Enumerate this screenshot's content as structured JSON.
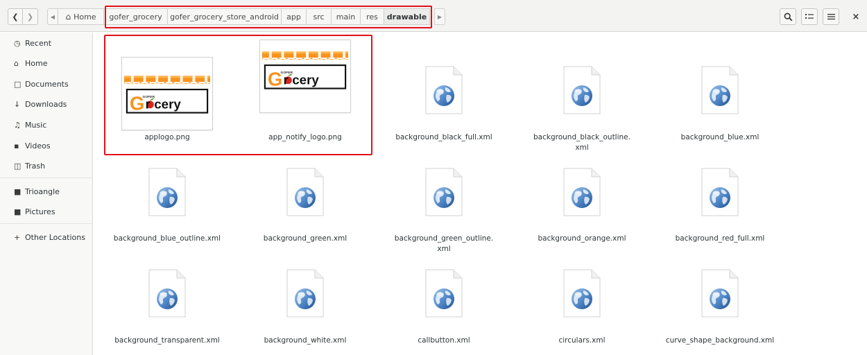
{
  "header": {
    "back_icon": "chevron-left-icon",
    "forward_icon": "chevron-right-icon",
    "home_label": "Home",
    "breadcrumbs": [
      "gofer_grocery",
      "gofer_grocery_store_android",
      "app",
      "src",
      "main",
      "res",
      "drawable"
    ],
    "highlight_color": "#e3101b"
  },
  "sidebar": {
    "items": [
      {
        "label": "Recent",
        "icon": "clock-icon"
      },
      {
        "label": "Home",
        "icon": "home-icon"
      },
      {
        "label": "Documents",
        "icon": "document-icon"
      },
      {
        "label": "Downloads",
        "icon": "download-icon"
      },
      {
        "label": "Music",
        "icon": "music-icon"
      },
      {
        "label": "Videos",
        "icon": "video-icon"
      },
      {
        "label": "Trash",
        "icon": "trash-icon"
      },
      {
        "label": "Trioangle",
        "icon": "folder-icon"
      },
      {
        "label": "Pictures",
        "icon": "folder-icon"
      },
      {
        "label": "Other Locations",
        "icon": "plus-icon"
      }
    ]
  },
  "files": [
    {
      "name": "applogo.png",
      "kind": "image"
    },
    {
      "name": "app_notify_logo.png",
      "kind": "image"
    },
    {
      "name": "background_black_full.xml",
      "kind": "xml"
    },
    {
      "name": "background_black_outline.",
      "name2": "xml",
      "kind": "xml"
    },
    {
      "name": "background_blue.xml",
      "kind": "xml"
    },
    {
      "name": "background_blue_outline.xml",
      "kind": "xml"
    },
    {
      "name": "background_green.xml",
      "kind": "xml"
    },
    {
      "name": "background_green_outline.",
      "name2": "xml",
      "kind": "xml"
    },
    {
      "name": "background_orange.xml",
      "kind": "xml"
    },
    {
      "name": "background_red_full.xml",
      "kind": "xml"
    },
    {
      "name": "background_transparent.xml",
      "kind": "xml"
    },
    {
      "name": "background_white.xml",
      "kind": "xml"
    },
    {
      "name": "callbutton.xml",
      "kind": "xml"
    },
    {
      "name": "circulars.xml",
      "kind": "xml"
    },
    {
      "name": "curve_shape_background.xml",
      "kind": "xml"
    }
  ],
  "logo": {
    "brand": "Grocery",
    "small": "GOFER",
    "awning_orange": "#f7931e",
    "accent_green": "#5aa02c",
    "accent_red": "#d7261e"
  }
}
